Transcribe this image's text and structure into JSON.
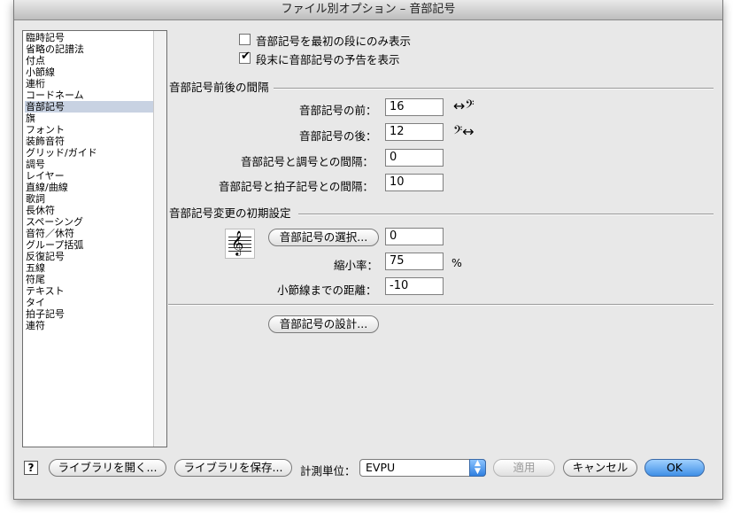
{
  "window": {
    "title": "ファイル別オプション – 音部記号"
  },
  "categories": [
    "臨時記号",
    "省略の記譜法",
    "付点",
    "小節線",
    "連桁",
    "コードネーム",
    "音部記号",
    "旗",
    "フォント",
    "装飾音符",
    "グリッド/ガイド",
    "調号",
    "レイヤー",
    "直線/曲線",
    "歌詞",
    "長休符",
    "スペーシング",
    "音符／休符",
    "グループ括弧",
    "反復記号",
    "五線",
    "符尾",
    "テキスト",
    "タイ",
    "拍子記号",
    "連符"
  ],
  "selected_category": "音部記号",
  "options": {
    "first_staff_only": {
      "label": "音部記号を最初の段にのみ表示",
      "checked": false
    },
    "courtesy_at_end": {
      "label": "段末に音部記号の予告を表示",
      "checked": true
    }
  },
  "spacing_section": {
    "title": "音部記号前後の間隔",
    "before": {
      "label": "音部記号の前：",
      "value": "16"
    },
    "after": {
      "label": "音部記号の後：",
      "value": "12"
    },
    "clef_to_key": {
      "label": "音部記号と調号との間隔：",
      "value": "0"
    },
    "clef_to_time": {
      "label": "音部記号と拍子記号との間隔：",
      "value": "10"
    }
  },
  "default_section": {
    "title": "音部記号変更の初期設定",
    "select_button": "音部記号の選択...",
    "clef_index": "0",
    "reduction": {
      "label": "縮小率：",
      "value": "75",
      "unit": "%"
    },
    "distance_to_barline": {
      "label": "小節線までの距離：",
      "value": "-10"
    }
  },
  "design_button": "音部記号の設計...",
  "footer": {
    "help": "?",
    "open_library": "ライブラリを開く...",
    "save_library": "ライブラリを保存...",
    "units_label": "計測単位：",
    "units_value": "EVPU",
    "apply": "適用",
    "cancel": "キャンセル",
    "ok": "OK"
  },
  "colors": {
    "accent": "#3f8fe6",
    "selection": "#c8d2e2",
    "window_bg": "#e8e8e8"
  }
}
